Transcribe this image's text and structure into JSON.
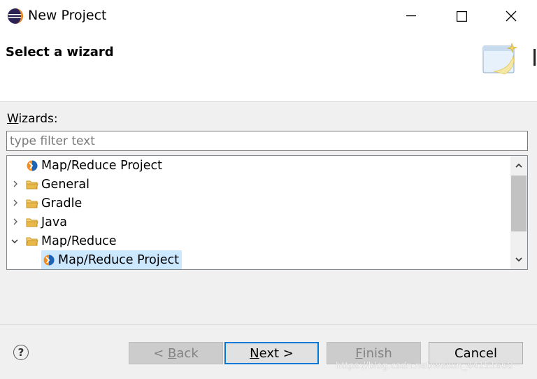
{
  "window": {
    "title": "New Project"
  },
  "banner": {
    "title": "Select a wizard"
  },
  "wizards": {
    "label_mnemonic": "W",
    "label_rest": "izards:",
    "filter_placeholder": "type filter text",
    "filter_value": ""
  },
  "tree": {
    "items": [
      {
        "label": "Map/Reduce Project",
        "icon": "mapreduce-project-icon",
        "expandable": false,
        "expanded": false
      },
      {
        "label": "General",
        "icon": "folder-icon",
        "expandable": true,
        "expanded": false
      },
      {
        "label": "Gradle",
        "icon": "folder-icon",
        "expandable": true,
        "expanded": false
      },
      {
        "label": "Java",
        "icon": "folder-icon",
        "expandable": true,
        "expanded": false
      },
      {
        "label": "Map/Reduce",
        "icon": "folder-icon",
        "expandable": true,
        "expanded": true
      },
      {
        "label": "Map/Reduce Project",
        "icon": "mapreduce-project-icon",
        "expandable": false,
        "expanded": false,
        "selected": true
      }
    ]
  },
  "buttons": {
    "back_prefix": "< ",
    "back_mnemonic": "B",
    "back_rest": "ack",
    "next_mnemonic": "N",
    "next_rest": "ext >",
    "finish_mnemonic": "F",
    "finish_rest": "inish",
    "cancel": "Cancel",
    "help": "?"
  },
  "watermark": "https://blog.csdn.net/weixin_44151660",
  "colors": {
    "selection": "#cce8ff",
    "focus_border": "#0078d7",
    "folder": "#e8b84a"
  }
}
